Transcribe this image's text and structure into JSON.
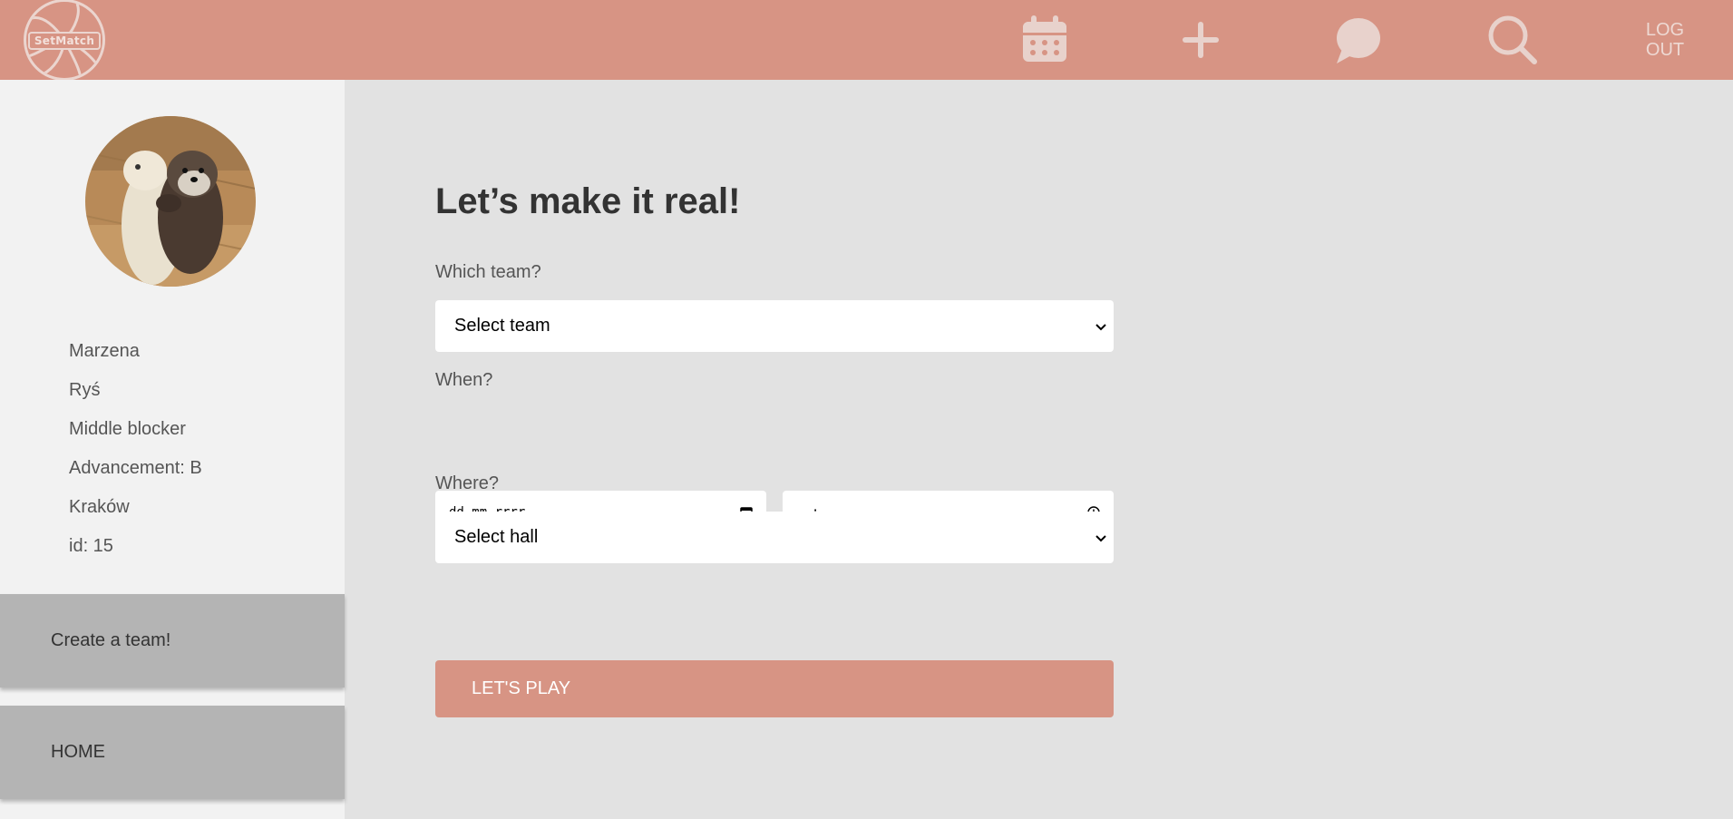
{
  "app": {
    "logo_text": "SetMatch"
  },
  "header": {
    "icons": [
      "calendar-icon",
      "plus-icon",
      "chat-icon",
      "search-icon"
    ],
    "logout_line1": "LOG",
    "logout_line2": "OUT",
    "icon_color": "#e8d2cc",
    "bar_color": "#d79484"
  },
  "profile": {
    "first_name": "Marzena",
    "last_name": "Ryś",
    "position": "Middle blocker",
    "advancement": "Advancement: B",
    "city": "Kraków",
    "id": "id: 15"
  },
  "sidebar": {
    "create_team": "Create a team!",
    "home": "HOME"
  },
  "form": {
    "title": "Let’s make it real!",
    "team_label": "Which team?",
    "team_select": "Select team",
    "when_label": "When?",
    "date_placeholder": "dd.mm.rrrr",
    "time_placeholder": "--:--",
    "where_label": "Where?",
    "hall_select": "Select hall",
    "submit": "LET'S PLAY",
    "accent": "#d79484"
  }
}
